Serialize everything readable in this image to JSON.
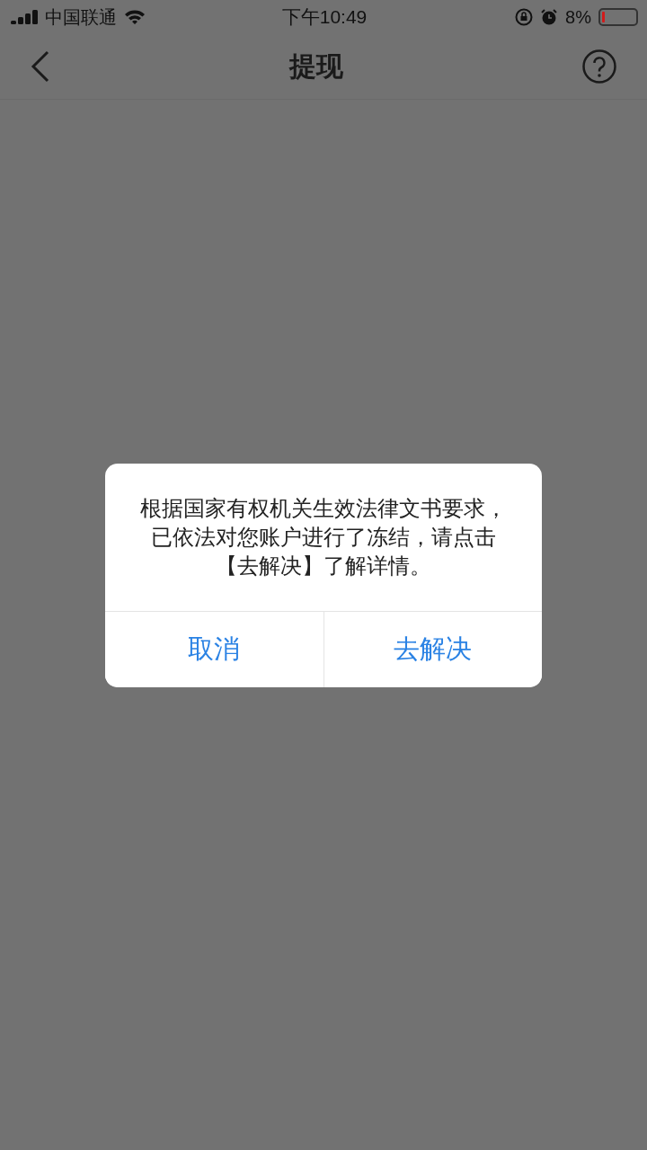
{
  "status_bar": {
    "carrier": "中国联通",
    "time": "下午10:49",
    "battery_percent": "8%",
    "battery": {
      "level": 0.08
    }
  },
  "nav_bar": {
    "title": "提现"
  },
  "dialog": {
    "message": "根据国家有权机关生效法律文书要求，已依法对您账户进行了冻结，请点击【去解决】了解详情。",
    "buttons": [
      {
        "label": "取消"
      },
      {
        "label": "去解决"
      }
    ]
  }
}
